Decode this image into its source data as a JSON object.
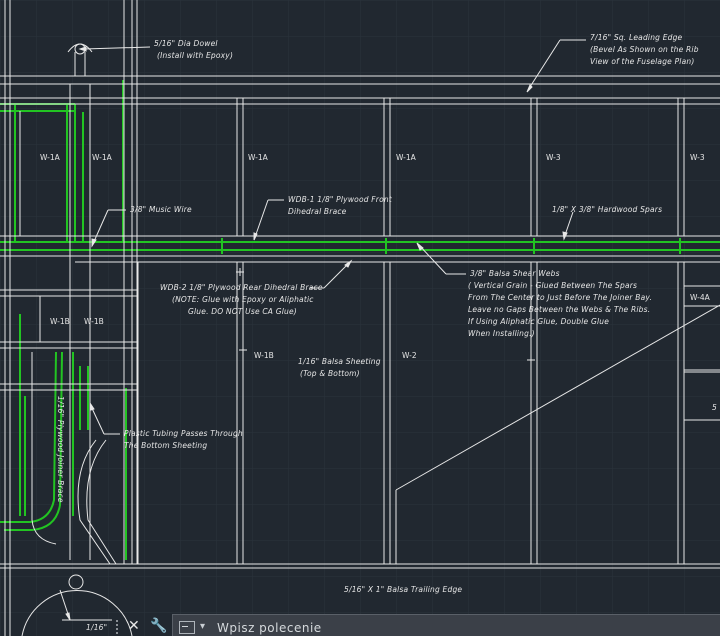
{
  "notes": {
    "dowel": [
      "5/16\" Dia Dowel",
      "(Install with Epoxy)"
    ],
    "leading_edge": [
      "7/16\" Sq. Leading Edge",
      "(Bevel As Shown on the Rib",
      "View of the Fuselage Plan)"
    ],
    "music_wire": "3/8\" Music Wire",
    "wdb1": [
      "WDB-1 1/8\" Plywood Front",
      "Dihedral Brace"
    ],
    "spar": "1/8\" X 3/8\" Hardwood Spars",
    "wdb2": [
      "WDB-2 1/8\" Plywood Rear Dihedral Brace",
      "(NOTE: Glue with Epoxy or Aliphatic",
      "Glue. DO NOT Use CA Glue)"
    ],
    "shear_webs": [
      "3/8\" Balsa Shear Webs",
      "( Vertical Grain - Glued Between The Spars",
      "From The Center to Just Before The Joiner Bay.",
      "Leave no Gaps Between the Webs & The Ribs.",
      "If Using Aliphatic Glue, Double Glue",
      "When Installing.)"
    ],
    "sheeting": [
      "1/16\" Balsa Sheeting",
      "(Top & Bottom)"
    ],
    "tubing": [
      "Plastic Tubing Passes Through",
      "The Bottom Sheeting"
    ],
    "joiner_brace": "1/16\" Plywood Joiner Brace",
    "trailing_edge": "5/16\" X 1\" Balsa Trailing Edge",
    "bottom_dim": "1/16\"",
    "partial_right": "5"
  },
  "ribs": {
    "w1a_1": "W-1A",
    "w1a_2": "W-1A",
    "w1a_3": "W-1A",
    "w1a_4": "W-1A",
    "w3_1": "W-3",
    "w3_2": "W-3",
    "w1b_1": "W-1B",
    "w1b_2": "W-1B",
    "w1b_3": "W-1B",
    "w2": "W-2",
    "w4a": "W-4A"
  },
  "command_line": {
    "placeholder": "Wpisz polecenie",
    "close_icon": "close-icon",
    "settings_icon": "wrench-icon",
    "prompt_icon": "command-prompt-icon"
  },
  "colors": {
    "background": "#212830",
    "lines": "#e8e8e8",
    "green": "#1fbf1f",
    "grid": "#2b333c"
  }
}
